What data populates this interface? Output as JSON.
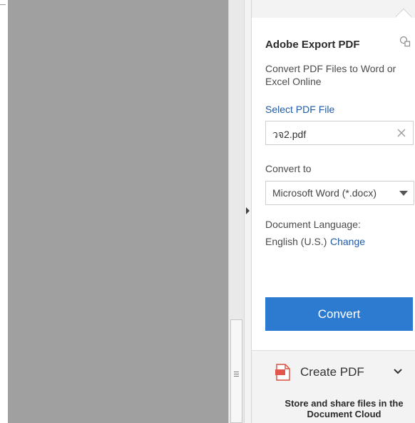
{
  "export_pdf": {
    "title": "Adobe Export PDF",
    "description": "Convert PDF Files to Word or Excel Online",
    "select_file_link": "Select PDF File",
    "file_value": "วจ2.pdf",
    "convert_to_label": "Convert to",
    "format_selected": "Microsoft Word (*.docx)",
    "document_language_label": "Document Language:",
    "document_language_value": "English (U.S.)",
    "change_link": "Change",
    "convert_button": "Convert"
  },
  "create_pdf": {
    "label": "Create PDF"
  },
  "cloud": {
    "line1": "Store and share files in the",
    "line2": "Document Cloud"
  },
  "colors": {
    "accent": "#2d7ad1",
    "link": "#1f5aa6",
    "document_background": "#a0a0a0"
  },
  "icons": [
    "copy-icon",
    "clear-icon",
    "dropdown-caret-icon",
    "collapse-arrow-icon",
    "pdf-icon",
    "chevron-down-icon",
    "scroll-grip-icon"
  ]
}
